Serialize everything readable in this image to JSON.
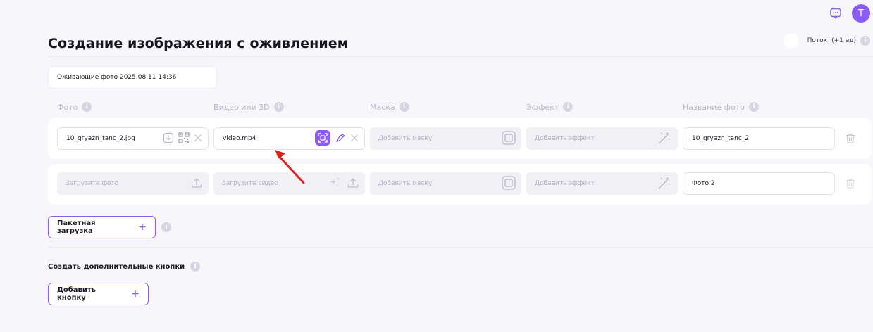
{
  "header": {
    "avatar_letter": "T"
  },
  "page": {
    "title": "Создание изображения с оживлением",
    "stream_label": "Поток",
    "stream_cost": "(+1 ед)",
    "name_value": "Оживающие фото 2025.08.11 14:36"
  },
  "columns": {
    "photo": "Фото",
    "video": "Видео или 3D",
    "mask": "Маска",
    "effect": "Эффект",
    "photo_name": "Название фото"
  },
  "rows": [
    {
      "photo": "10_gryazn_tanc_2.jpg",
      "video": "video.mp4",
      "mask": "Добавить маску",
      "effect": "Добавить эффект",
      "name": "10_gryazn_tanc_2"
    },
    {
      "photo": "Загрузите фото",
      "video": "Загрузите видео",
      "mask": "Добавить маску",
      "effect": "Добавить эффект",
      "name": "Фото 2"
    }
  ],
  "actions": {
    "batch_upload": "Пакетная загрузка",
    "plus": "+",
    "extra_buttons_label": "Создать дополнительные кнопки",
    "add_button": "Добавить кнопку"
  },
  "colors": {
    "accent": "#8b5cf6",
    "annotation_arrow": "#e02020"
  }
}
